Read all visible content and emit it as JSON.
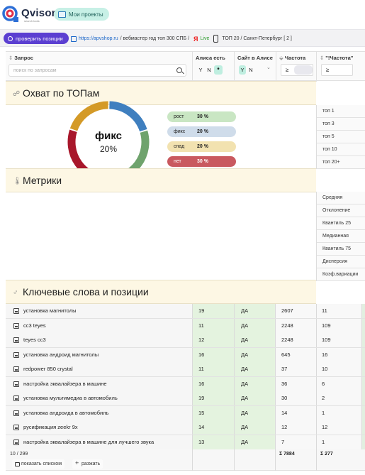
{
  "header": {
    "logo_text": "Qvisor",
    "logo_sub": "search tools",
    "my_projects": "Мои проекты"
  },
  "toolbar": {
    "check_button": "проверить позиции",
    "site_url": "https://apvshop.ru",
    "project_desc": "/ вебмастер год топ 300 СПБ /",
    "yandex": "Я",
    "live": "Live",
    "region": "ТОП 20 / Санкт-Петербург [ 2 ]"
  },
  "table_header": {
    "query_title": "Запрос",
    "search_placeholder": "поиск по запросам",
    "alice_title": "Алиса есть",
    "site_in_alice_title": "Сайт в Алисе",
    "freq_title": "Частота",
    "quote_freq_title": "\"!Частота\"",
    "yes": "Y",
    "no": "N",
    "ge": "≥"
  },
  "coverage": {
    "title": "Охват по ТОПам",
    "center_label": "фикс",
    "center_value": "20%",
    "legend": [
      {
        "name": "рост",
        "value": "30 %",
        "color": "#c9e6c3"
      },
      {
        "name": "фикс",
        "value": "20 %",
        "color": "#cfdcea"
      },
      {
        "name": "спад",
        "value": "20 %",
        "color": "#f2e2b0"
      },
      {
        "name": "нет",
        "value": "30 %",
        "color": "#c9595f"
      }
    ],
    "tops": [
      "топ 1",
      "топ 3",
      "топ 5",
      "топ 10",
      "топ 20+"
    ],
    "donut_segments": [
      {
        "name": "фикс",
        "value": 20,
        "color": "#3f7fbf"
      },
      {
        "name": "рост",
        "value": 30,
        "color": "#6fa36d"
      },
      {
        "name": "нет",
        "value": 30,
        "color": "#a8172b"
      },
      {
        "name": "спад",
        "value": 20,
        "color": "#d49a27"
      }
    ]
  },
  "metrics": {
    "title": "Метрики",
    "rows": [
      "Средняя",
      "Отклонение",
      "Квантиль 25",
      "Медианная",
      "Квантиль 75",
      "Дисперсия",
      "Коэф.вариации"
    ]
  },
  "keywords": {
    "title": "Ключевые слова и позиции",
    "rows": [
      {
        "query": "установка магнитолы",
        "alice": "19",
        "site": "ДА",
        "freq": "2607",
        "qfreq": "11"
      },
      {
        "query": "cc3 teyes",
        "alice": "11",
        "site": "ДА",
        "freq": "2248",
        "qfreq": "109"
      },
      {
        "query": "teyes cc3",
        "alice": "12",
        "site": "ДА",
        "freq": "2248",
        "qfreq": "109"
      },
      {
        "query": "установка андроид магнитолы",
        "alice": "16",
        "site": "ДА",
        "freq": "645",
        "qfreq": "16"
      },
      {
        "query": "redpower 850 crystal",
        "alice": "11",
        "site": "ДА",
        "freq": "37",
        "qfreq": "10"
      },
      {
        "query": "настройка эквалайзера в машине",
        "alice": "16",
        "site": "ДА",
        "freq": "36",
        "qfreq": "6"
      },
      {
        "query": "установка мультимедиа в автомобиль",
        "alice": "19",
        "site": "ДА",
        "freq": "30",
        "qfreq": "2"
      },
      {
        "query": "установка андроида в автомобиль",
        "alice": "15",
        "site": "ДА",
        "freq": "14",
        "qfreq": "1"
      },
      {
        "query": "русификация zeekr 9x",
        "alice": "14",
        "site": "ДА",
        "freq": "12",
        "qfreq": "12"
      },
      {
        "query": "настройка эквалайзера в машине для лучшего звука",
        "alice": "13",
        "site": "ДА",
        "freq": "7",
        "qfreq": "1"
      }
    ],
    "count": "10 / 299",
    "sum_freq": "Σ 7884",
    "sum_qfreq": "Σ 277",
    "show_list": "показать списком",
    "expand": "разжать"
  }
}
